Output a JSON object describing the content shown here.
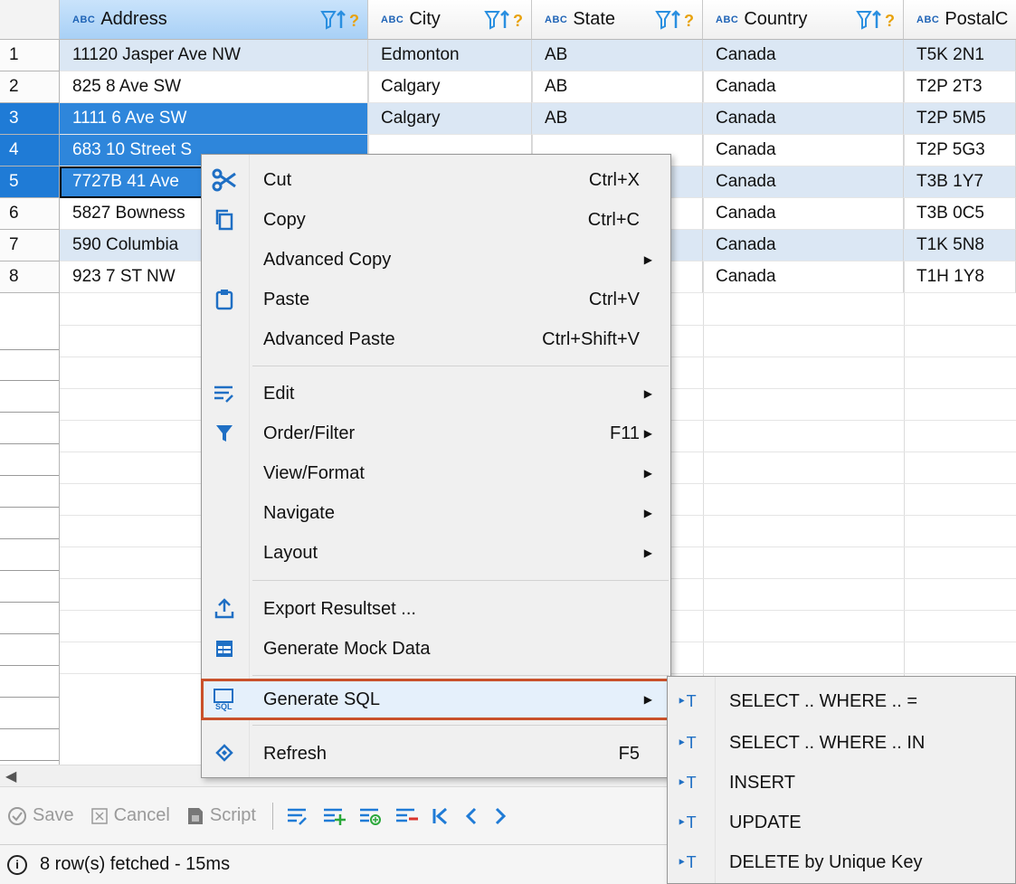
{
  "grid": {
    "columns": [
      {
        "type": "ABC",
        "name": "Address"
      },
      {
        "type": "ABC",
        "name": "City"
      },
      {
        "type": "ABC",
        "name": "State"
      },
      {
        "type": "ABC",
        "name": "Country"
      },
      {
        "type": "ABC",
        "name": "PostalC"
      }
    ],
    "rows": [
      {
        "num": "1",
        "address": "11120 Jasper Ave NW",
        "city": "Edmonton",
        "state": "AB",
        "country": "Canada",
        "postal": "T5K 2N1"
      },
      {
        "num": "2",
        "address": "825 8 Ave SW",
        "city": "Calgary",
        "state": "AB",
        "country": "Canada",
        "postal": "T2P 2T3"
      },
      {
        "num": "3",
        "address": "1111 6 Ave SW",
        "city": "Calgary",
        "state": "AB",
        "country": "Canada",
        "postal": "T2P 5M5"
      },
      {
        "num": "4",
        "address": "683 10 Street S",
        "city": "",
        "state": "",
        "country": "Canada",
        "postal": "T2P 5G3"
      },
      {
        "num": "5",
        "address": "7727B 41 Ave",
        "city": "",
        "state": "",
        "country": "Canada",
        "postal": "T3B 1Y7"
      },
      {
        "num": "6",
        "address": "5827 Bowness",
        "city": "",
        "state": "",
        "country": "Canada",
        "postal": "T3B 0C5"
      },
      {
        "num": "7",
        "address": "590 Columbia",
        "city": "",
        "state": "",
        "country": "Canada",
        "postal": "T1K 5N8"
      },
      {
        "num": "8",
        "address": "923 7 ST NW",
        "city": "",
        "state": "",
        "country": "Canada",
        "postal": "T1H 1Y8"
      }
    ]
  },
  "context_menu": {
    "items": [
      {
        "icon": "scissors-icon",
        "label": "Cut",
        "shortcut": "Ctrl+X"
      },
      {
        "icon": "copy-icon",
        "label": "Copy",
        "shortcut": "Ctrl+C"
      },
      {
        "icon": "",
        "label": "Advanced Copy",
        "shortcut": ""
      },
      {
        "icon": "paste-icon",
        "label": "Paste",
        "shortcut": "Ctrl+V"
      },
      {
        "icon": "",
        "label": "Advanced Paste",
        "shortcut": "Ctrl+Shift+V"
      },
      {
        "icon": "edit-icon",
        "label": "Edit",
        "shortcut": ""
      },
      {
        "icon": "filter-icon",
        "label": "Order/Filter",
        "shortcut": "F11"
      },
      {
        "icon": "",
        "label": "View/Format",
        "shortcut": ""
      },
      {
        "icon": "",
        "label": "Navigate",
        "shortcut": ""
      },
      {
        "icon": "",
        "label": "Layout",
        "shortcut": ""
      },
      {
        "icon": "export-icon",
        "label": "Export Resultset ...",
        "shortcut": ""
      },
      {
        "icon": "mock-data-icon",
        "label": "Generate Mock Data",
        "shortcut": ""
      },
      {
        "icon": "sql-icon",
        "label": "Generate SQL",
        "shortcut": ""
      },
      {
        "icon": "refresh-icon",
        "label": "Refresh",
        "shortcut": "F5"
      }
    ]
  },
  "submenu": {
    "items": [
      {
        "label": "SELECT .. WHERE .. ="
      },
      {
        "label": "SELECT .. WHERE .. IN"
      },
      {
        "label": "INSERT"
      },
      {
        "label": "UPDATE"
      },
      {
        "label": "DELETE by Unique Key"
      }
    ]
  },
  "toolbar": {
    "save_label": "Save",
    "cancel_label": "Cancel",
    "script_label": "Script"
  },
  "status": {
    "text": "8 row(s) fetched - 15ms"
  }
}
